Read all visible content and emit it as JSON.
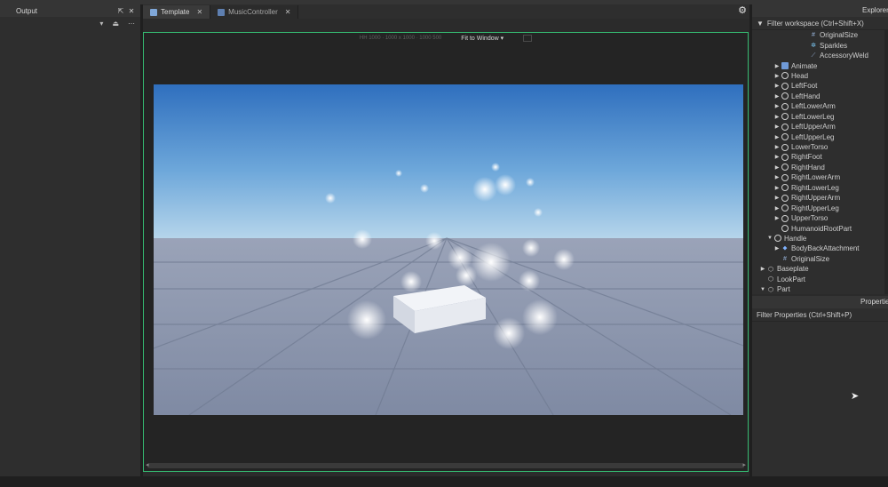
{
  "output_panel": {
    "title": "Output",
    "pop_icon": "popout-icon",
    "close": "✕",
    "dropdown_arrow": "▾",
    "more": "⋯"
  },
  "tabs": [
    {
      "label": "Template",
      "close": "✕",
      "active": true
    },
    {
      "label": "MusicController",
      "close": "✕",
      "active": false
    }
  ],
  "viewport": {
    "stats": "HH 1000 · 1000 x 1000 · 1000 500",
    "fit_label": "Fit to Window",
    "fit_arrow": "▾",
    "colors": {
      "border": "#35b870",
      "sky_top": "#2f6fbe",
      "sky_bottom": "#a9cfe8",
      "floor": "#8f98ad"
    }
  },
  "explorer": {
    "title": "Explorer",
    "filter_placeholder": "Filter workspace (Ctrl+Shift+X)",
    "items": [
      {
        "label": "OriginalSize",
        "icon": "value-icon",
        "indent": 7,
        "arrow": ""
      },
      {
        "label": "Sparkles",
        "icon": "sparkles-icon",
        "indent": 7,
        "arrow": ""
      },
      {
        "label": "AccessoryWeld",
        "icon": "weld-icon",
        "indent": 7,
        "arrow": ""
      },
      {
        "label": "Animate",
        "icon": "script-icon",
        "indent": 3,
        "arrow": "▶"
      },
      {
        "label": "Head",
        "icon": "part-icon",
        "indent": 3,
        "arrow": "▶"
      },
      {
        "label": "LeftFoot",
        "icon": "part-icon",
        "indent": 3,
        "arrow": "▶"
      },
      {
        "label": "LeftHand",
        "icon": "part-icon",
        "indent": 3,
        "arrow": "▶"
      },
      {
        "label": "LeftLowerArm",
        "icon": "part-icon",
        "indent": 3,
        "arrow": "▶"
      },
      {
        "label": "LeftLowerLeg",
        "icon": "part-icon",
        "indent": 3,
        "arrow": "▶"
      },
      {
        "label": "LeftUpperArm",
        "icon": "part-icon",
        "indent": 3,
        "arrow": "▶"
      },
      {
        "label": "LeftUpperLeg",
        "icon": "part-icon",
        "indent": 3,
        "arrow": "▶"
      },
      {
        "label": "LowerTorso",
        "icon": "part-icon",
        "indent": 3,
        "arrow": "▶"
      },
      {
        "label": "RightFoot",
        "icon": "part-icon",
        "indent": 3,
        "arrow": "▶"
      },
      {
        "label": "RightHand",
        "icon": "part-icon",
        "indent": 3,
        "arrow": "▶"
      },
      {
        "label": "RightLowerArm",
        "icon": "part-icon",
        "indent": 3,
        "arrow": "▶"
      },
      {
        "label": "RightLowerLeg",
        "icon": "part-icon",
        "indent": 3,
        "arrow": "▶"
      },
      {
        "label": "RightUpperArm",
        "icon": "part-icon",
        "indent": 3,
        "arrow": "▶"
      },
      {
        "label": "RightUpperLeg",
        "icon": "part-icon",
        "indent": 3,
        "arrow": "▶"
      },
      {
        "label": "UpperTorso",
        "icon": "part-icon",
        "indent": 3,
        "arrow": "▶"
      },
      {
        "label": "HumanoidRootPart",
        "icon": "part-icon",
        "indent": 3,
        "arrow": ""
      },
      {
        "label": "Handle",
        "icon": "part-icon",
        "indent": 2,
        "arrow": "▼"
      },
      {
        "label": "BodyBackAttachment",
        "icon": "attachment-icon",
        "indent": 3,
        "arrow": "▶"
      },
      {
        "label": "OriginalSize",
        "icon": "value-icon",
        "indent": 3,
        "arrow": ""
      },
      {
        "label": "Baseplate",
        "icon": "model-icon",
        "indent": 1,
        "arrow": "▶"
      },
      {
        "label": "LookPart",
        "icon": "model-icon",
        "indent": 1,
        "arrow": ""
      },
      {
        "label": "Part",
        "icon": "model-icon",
        "indent": 1,
        "arrow": "▼"
      }
    ]
  },
  "properties": {
    "title": "Properties",
    "filter_placeholder": "Filter Properties (Ctrl+Shift+P)"
  }
}
